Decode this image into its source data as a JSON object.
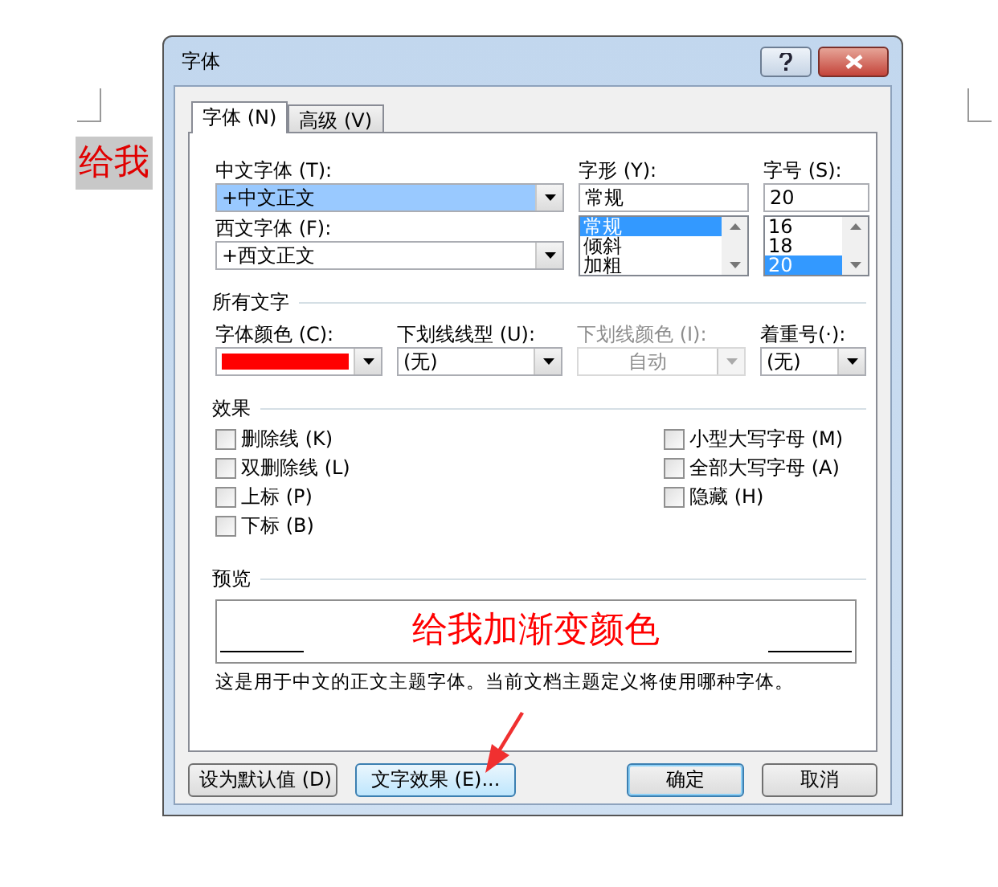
{
  "document": {
    "text": "给我"
  },
  "window": {
    "title": "字体"
  },
  "tabs": [
    {
      "label": "字体 (N)",
      "selected": true
    },
    {
      "label": "高级 (V)",
      "selected": false
    }
  ],
  "chinese_font": {
    "label": "中文字体 (T):",
    "value": "+中文正文"
  },
  "western_font": {
    "label": "西文字体 (F):",
    "value": "+西文正文"
  },
  "font_style": {
    "label": "字形 (Y):",
    "value": "常规",
    "options": [
      {
        "label": "常规",
        "selected": true
      },
      {
        "label": "倾斜",
        "selected": false
      },
      {
        "label": "加粗",
        "selected": false
      }
    ]
  },
  "font_size": {
    "label": "字号 (S):",
    "value": "20",
    "options": [
      {
        "label": "16",
        "selected": false
      },
      {
        "label": "18",
        "selected": false
      },
      {
        "label": "20",
        "selected": true
      }
    ]
  },
  "all_text": {
    "heading": "所有文字",
    "font_color": {
      "label": "字体颜色 (C):",
      "color": "#ff0000"
    },
    "underline_style": {
      "label": "下划线线型 (U):",
      "value": "(无)"
    },
    "underline_color": {
      "label": "下划线颜色 (I):",
      "value": "自动",
      "disabled": true
    },
    "emphasis_mark": {
      "label": "着重号(·):",
      "value": "(无)"
    }
  },
  "effects": {
    "heading": "效果",
    "left": [
      {
        "label": "删除线 (K)",
        "checked": false
      },
      {
        "label": "双删除线 (L)",
        "checked": false
      },
      {
        "label": "上标 (P)",
        "checked": false
      },
      {
        "label": "下标 (B)",
        "checked": false
      }
    ],
    "right": [
      {
        "label": "小型大写字母 (M)",
        "checked": false
      },
      {
        "label": "全部大写字母 (A)",
        "checked": false
      },
      {
        "label": "隐藏 (H)",
        "checked": false
      }
    ]
  },
  "preview": {
    "heading": "预览",
    "sample": "给我加渐变颜色",
    "description": "这是用于中文的正文主题字体。当前文档主题定义将使用哪种字体。"
  },
  "buttons": [
    {
      "label": "设为默认值 (D)",
      "default": false,
      "hovered": false
    },
    {
      "label": "文字效果 (E)...",
      "default": false,
      "hovered": true
    },
    {
      "label": "确定",
      "default": true,
      "hovered": false
    },
    {
      "label": "取消",
      "default": false,
      "hovered": false
    }
  ]
}
